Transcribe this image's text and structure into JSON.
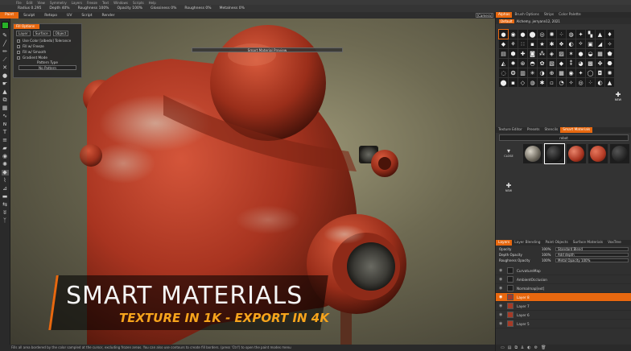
{
  "menu": [
    "File",
    "Edit",
    "View",
    "Symmetry",
    "Layers",
    "Freeze",
    "Text",
    "Windows",
    "Scripts",
    "Help"
  ],
  "tool_options": [
    {
      "label": "Radius",
      "value": "0.295"
    },
    {
      "label": "Depth",
      "value": "40%"
    },
    {
      "label": "Roughness",
      "value": "100%"
    },
    {
      "label": "Opacity",
      "value": "100%"
    },
    {
      "label": "Glossiness",
      "value": "0%"
    },
    {
      "label": "Roughness",
      "value": "0%"
    },
    {
      "label": "Metalness",
      "value": "0%"
    }
  ],
  "modes": [
    "Paint",
    "Sculpt",
    "Retopo",
    "UV",
    "Script",
    "Render"
  ],
  "active_mode": "Paint",
  "camera_label": "[Camera]",
  "fill_panel": {
    "header": "Fill Options",
    "tabs": [
      "Layer",
      "Surface",
      "Object"
    ],
    "options": [
      "Use Color [albedo] Tolerance",
      "Fill w/ Freeze",
      "Fill w/ Smooth",
      "Gradient Mode"
    ],
    "pattern_type_label": "Pattern Type",
    "pattern_value": "No Pattern"
  },
  "preview_title": "Smart Material Preview",
  "banner": {
    "title": "SMART MATERIALS",
    "subtitle": "TEXTURE IN 1K - EXPORT IN 4K"
  },
  "status_text": "Fills all area bordered by the color sampled at the cursor, excluding frozen areas. You can also use contours to create fill borders. (press 'Ctrl') to open the paint modes menu",
  "right_tabs": [
    "Alphas",
    "Brush Options",
    "Strips",
    "Color Palette"
  ],
  "alpha_bar": [
    "Default",
    "Alchemy, jerryann12, 2021"
  ],
  "new_brush_label": "NEW",
  "sm_tabs": [
    "Texture Editor",
    "Presets",
    "Stencils",
    "Smart Materials"
  ],
  "sm_search": "robot",
  "sm_add_label": "NEW",
  "sm_folder_label": "CLOSE",
  "layer_tabs": [
    "Layers",
    "Layer Blending",
    "Paint Objects",
    "Surface Materials",
    "VoxTree"
  ],
  "layer_props": [
    {
      "label": "Opacity",
      "value": "100%",
      "box": "Standard Blend"
    },
    {
      "label": "Depth Opacity",
      "value": "100%",
      "box": "Add depth"
    },
    {
      "label": "Roughness Opacity",
      "value": "100%",
      "box": "Metal Opacity 100%"
    }
  ],
  "layers": [
    {
      "name": "CurvatureMap",
      "selected": false,
      "thumb": "dark"
    },
    {
      "name": "AmbientOcclusion",
      "selected": false,
      "thumb": "dark"
    },
    {
      "name": "Normalmap[ext]",
      "selected": false,
      "thumb": "dark"
    },
    {
      "name": "Layer 8",
      "selected": true,
      "thumb": "red"
    },
    {
      "name": "Layer 7",
      "selected": false,
      "thumb": "red"
    },
    {
      "name": "Layer 6",
      "selected": false,
      "thumb": "red"
    },
    {
      "name": "Layer 5",
      "selected": false,
      "thumb": "red"
    }
  ],
  "colors": {
    "accent": "#e8680f",
    "robot": "#b23a24",
    "banner_sub": "#f7a41c",
    "primary_color": "#28b028"
  }
}
